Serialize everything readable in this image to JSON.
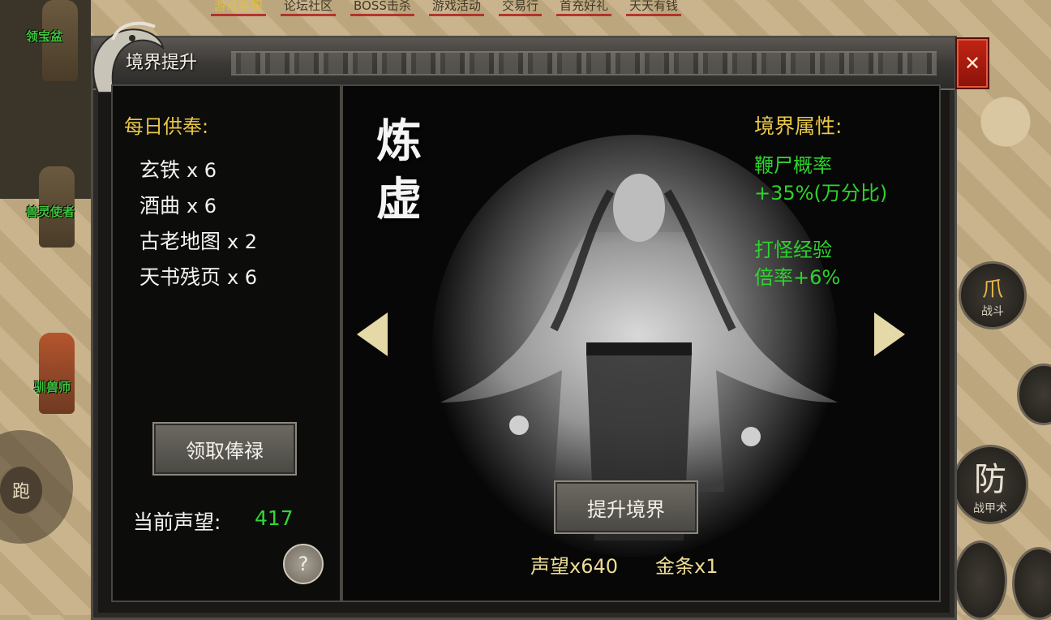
{
  "top_menu": [
    "游戏客服",
    "论坛社区",
    "BOSS击杀",
    "游戏活动",
    "交易行",
    "首充好礼",
    "天天有钱"
  ],
  "npcs": [
    "领宝盆",
    "兽灵使者",
    "驯兽师"
  ],
  "hud": {
    "run": "跑",
    "skills": [
      {
        "icon": "爪",
        "label": "战斗"
      },
      {
        "icon": "防",
        "label": "战甲术"
      }
    ]
  },
  "panel": {
    "title": "境界提升",
    "close": "✕"
  },
  "daily": {
    "title": "每日供奉:",
    "items": [
      {
        "name": "玄铁",
        "qty": "x 6"
      },
      {
        "name": "酒曲",
        "qty": "x 6"
      },
      {
        "name": "古老地图",
        "qty": "x 2"
      },
      {
        "name": "天书残页",
        "qty": "x 6"
      }
    ],
    "claim_button": "领取俸禄",
    "reputation_label": "当前声望:",
    "reputation_value": "417",
    "help": "?"
  },
  "realm": {
    "name_line1": "炼",
    "name_line2": "虚",
    "upgrade_button": "提升境界",
    "cost_reputation": "声望x640",
    "cost_gold": "金条x1"
  },
  "attributes": {
    "title": "境界属性:",
    "lines": [
      "鞭尸概率",
      "+35%(万分比)",
      "打怪经验",
      "倍率+6%"
    ]
  },
  "colors": {
    "gold_title": "#e8c749",
    "green_value": "#2fd22f",
    "close_red": "#c12414"
  }
}
